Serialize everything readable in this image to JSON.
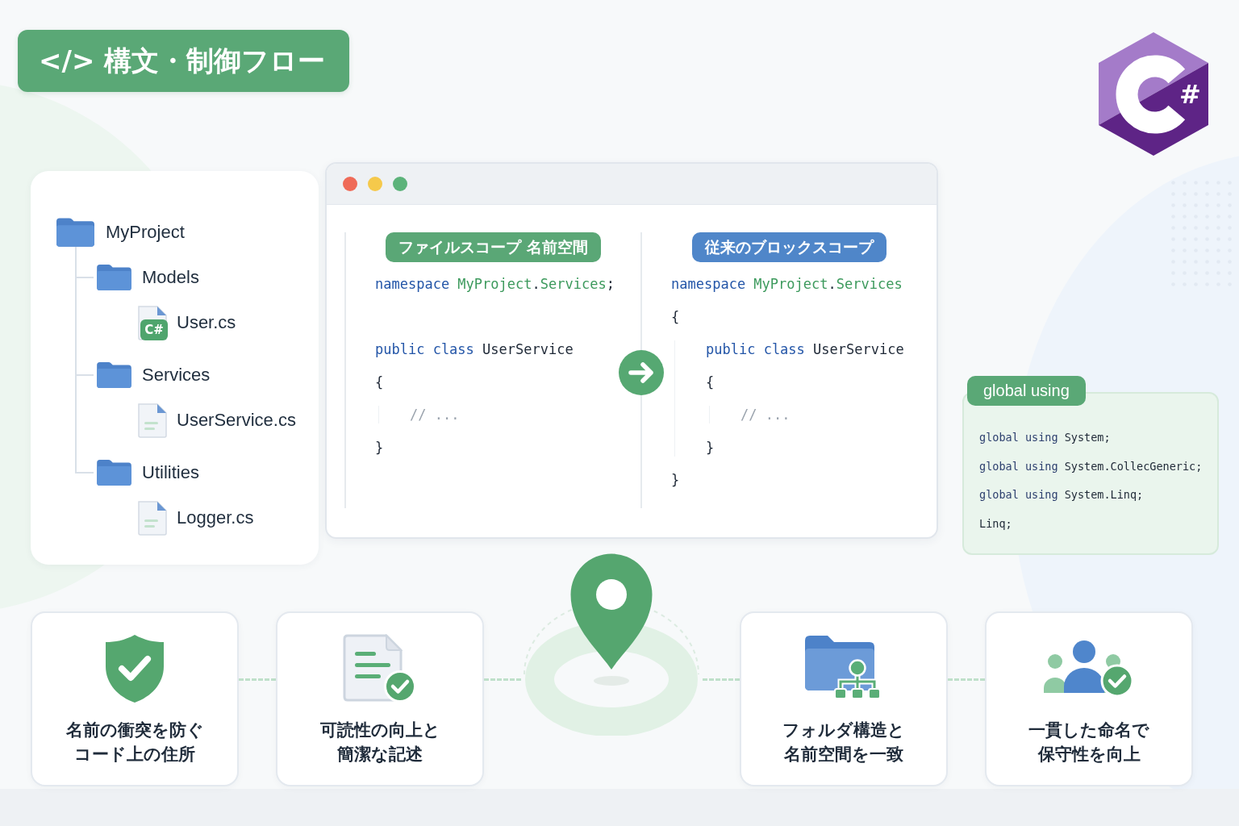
{
  "title": "</> 構文・制御フロー",
  "logo": {
    "symbol": "#"
  },
  "project_tree": [
    {
      "name": "MyProject",
      "kind": "folder",
      "children": [
        {
          "name": "Models",
          "kind": "folder",
          "children": [
            {
              "name": "User.cs",
              "kind": "csharp-file",
              "badge": "C#"
            }
          ]
        },
        {
          "name": "Services",
          "kind": "folder",
          "children": [
            {
              "name": "UserService.cs",
              "kind": "file"
            }
          ]
        },
        {
          "name": "Utilities",
          "kind": "folder",
          "children": [
            {
              "name": "Logger.cs",
              "kind": "file"
            }
          ]
        }
      ]
    }
  ],
  "code_window": {
    "panes": [
      {
        "label": "ファイルスコープ 名前空間",
        "color": "#5aa776",
        "lines": [
          {
            "kind": "code",
            "tokens": [
              {
                "kind": "keyword",
                "text": "namespace "
              },
              {
                "kind": "name",
                "text": "MyProject"
              },
              {
                "kind": "plain",
                "text": "."
              },
              {
                "kind": "name",
                "text": "Services"
              },
              {
                "kind": "plain",
                "text": ";"
              }
            ]
          },
          {
            "kind": "blank"
          },
          {
            "kind": "code",
            "tokens": [
              {
                "kind": "keyword",
                "text": "public class "
              },
              {
                "kind": "plain",
                "text": "UserService"
              }
            ]
          },
          {
            "kind": "code",
            "tokens": [
              {
                "kind": "plain",
                "text": "{"
              }
            ],
            "children": [
              {
                "kind": "code",
                "tokens": [
                  {
                    "kind": "comment",
                    "text": "// ..."
                  }
                ]
              }
            ]
          },
          {
            "kind": "code",
            "tokens": [
              {
                "kind": "plain",
                "text": "}"
              }
            ]
          }
        ]
      },
      {
        "label": "従来のブロックスコープ",
        "color": "#4f86c9",
        "lines": [
          {
            "kind": "code",
            "tokens": [
              {
                "kind": "keyword",
                "text": "namespace "
              },
              {
                "kind": "name",
                "text": "MyProject"
              },
              {
                "kind": "plain",
                "text": "."
              },
              {
                "kind": "name",
                "text": "Services"
              }
            ]
          },
          {
            "kind": "code",
            "tokens": [
              {
                "kind": "plain",
                "text": "{"
              }
            ],
            "children": [
              {
                "kind": "code",
                "tokens": [
                  {
                    "kind": "keyword",
                    "text": "public class "
                  },
                  {
                    "kind": "plain",
                    "text": "UserService"
                  }
                ]
              },
              {
                "kind": "code",
                "tokens": [
                  {
                    "kind": "plain",
                    "text": "{"
                  }
                ],
                "children": [
                  {
                    "kind": "code",
                    "tokens": [
                      {
                        "kind": "comment",
                        "text": "// ..."
                      }
                    ]
                  }
                ]
              },
              {
                "kind": "code",
                "tokens": [
                  {
                    "kind": "plain",
                    "text": "}"
                  }
                ]
              }
            ]
          },
          {
            "kind": "code",
            "tokens": [
              {
                "kind": "plain",
                "text": "}"
              }
            ]
          }
        ]
      }
    ]
  },
  "global_using": {
    "label": "global using",
    "lines": [
      {
        "tokens": [
          {
            "kind": "keyword",
            "text": "global using "
          },
          {
            "kind": "plain",
            "text": "System;"
          }
        ]
      },
      {
        "tokens": [
          {
            "kind": "keyword",
            "text": "global using "
          },
          {
            "kind": "plain",
            "text": "System.CollecGeneric;"
          }
        ]
      },
      {
        "tokens": [
          {
            "kind": "keyword",
            "text": "global using "
          },
          {
            "kind": "plain",
            "text": "System.Linq;"
          }
        ]
      },
      {
        "tokens": [
          {
            "kind": "plain",
            "text": "Linq;"
          }
        ]
      }
    ]
  },
  "features": [
    {
      "kind": "shield",
      "lines": [
        "名前の衝突を防ぐ",
        "コード上の住所"
      ]
    },
    {
      "kind": "document",
      "lines": [
        "可読性の向上と",
        "簡潔な記述"
      ]
    },
    {
      "kind": "pin"
    },
    {
      "kind": "folder-tree",
      "lines": [
        "フォルダ構造と",
        "名前空間を一致"
      ]
    },
    {
      "kind": "team",
      "lines": [
        "一貫した命名で",
        "保守性を向上"
      ]
    }
  ]
}
